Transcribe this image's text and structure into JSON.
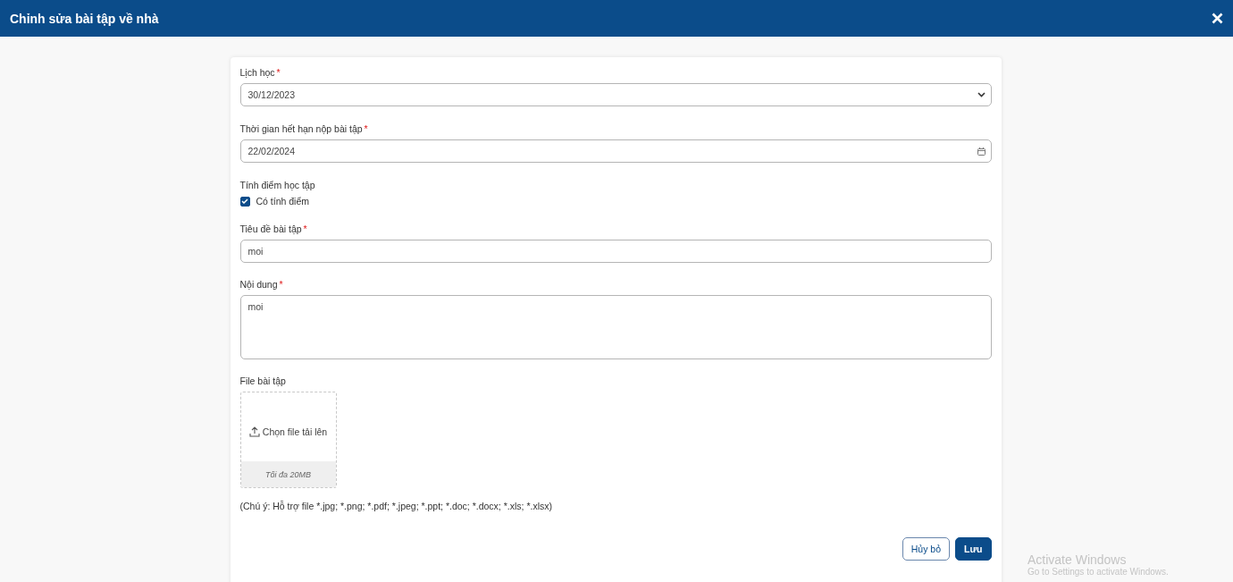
{
  "window": {
    "title": "Chỉnh sửa bài tập về nhà"
  },
  "fields": [
    {
      "kind": "select",
      "label": "Lịch học",
      "required_mark": "*",
      "value": "30/12/2023"
    },
    {
      "kind": "date",
      "label": "Thời gian hết hạn nộp bài tập",
      "required_mark": "*",
      "value": "22/02/2024"
    },
    {
      "kind": "checkbox",
      "label": "Tính điểm học tập",
      "option": "Có tính điểm",
      "checked": true
    },
    {
      "kind": "text",
      "label": "Tiêu đề bài tập",
      "required_mark": "*",
      "value": "moi"
    },
    {
      "kind": "textarea",
      "label": "Nội dung",
      "required_mark": "*",
      "value": "moi"
    },
    {
      "kind": "upload",
      "label": "File bài tập",
      "action": "Chọn file tải lên",
      "limit": "Tối đa 20MB",
      "note": "(Chú ý: Hỗ trợ file *.jpg; *.png; *.pdf; *.jpeg; *.ppt; *.doc; *.docx; *.xls; *.xlsx)"
    }
  ],
  "buttons": [
    {
      "label": "Hủy bỏ",
      "kind": "secondary"
    },
    {
      "label": "Lưu",
      "kind": "primary"
    }
  ],
  "os_notice": {
    "title": "Activate Windows",
    "text": "Go to Settings to activate Windows."
  }
}
